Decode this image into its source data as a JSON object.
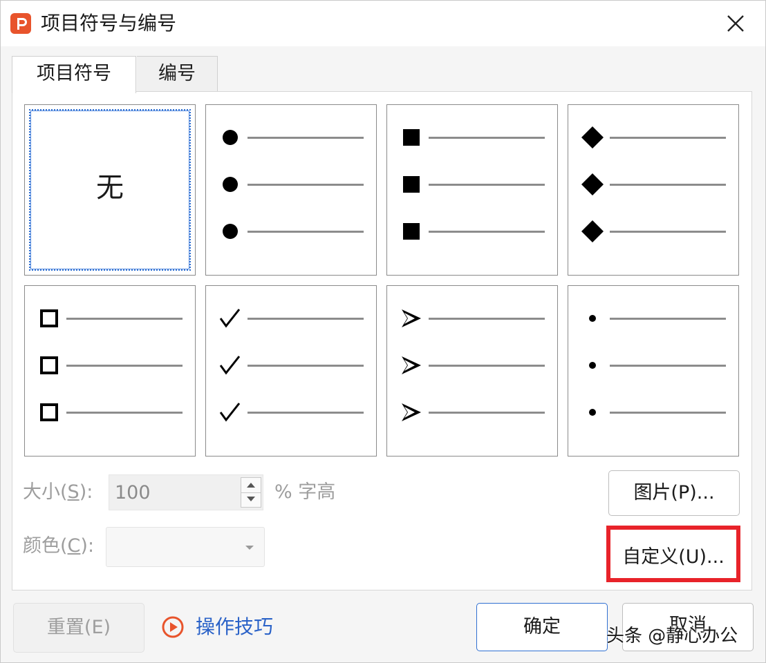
{
  "window": {
    "title": "项目符号与编号",
    "app_icon": "wps-presentation-icon",
    "close_icon": "close-icon"
  },
  "tabs": [
    {
      "label": "项目符号",
      "selected": true
    },
    {
      "label": "编号",
      "selected": false
    }
  ],
  "bullet_grid": {
    "none_label": "无",
    "items": [
      {
        "name": "none",
        "selected": true
      },
      {
        "name": "filled-circle"
      },
      {
        "name": "filled-square"
      },
      {
        "name": "filled-diamond"
      },
      {
        "name": "hollow-square"
      },
      {
        "name": "checkmark"
      },
      {
        "name": "arrowhead"
      },
      {
        "name": "small-dot"
      }
    ]
  },
  "options": {
    "size_label_prefix": "大小(",
    "size_label_key": "S",
    "size_label_suffix": "):",
    "size_value": "100",
    "size_unit": "% 字高",
    "color_label_prefix": "颜色(",
    "color_label_key": "C",
    "color_label_suffix": "):",
    "color_value": ""
  },
  "buttons": {
    "picture": "图片(P)...",
    "custom": "自定义(U)...",
    "reset": "重置(E)",
    "ok": "确定",
    "cancel": "取消"
  },
  "tips": {
    "label": "操作技巧",
    "icon": "play-circle-icon"
  },
  "watermark": "头条 @静心办公",
  "colors": {
    "accent": "#2f6fd1",
    "highlight": "#e8232a",
    "app_icon": "#e8542c",
    "link": "#2a62c8"
  }
}
